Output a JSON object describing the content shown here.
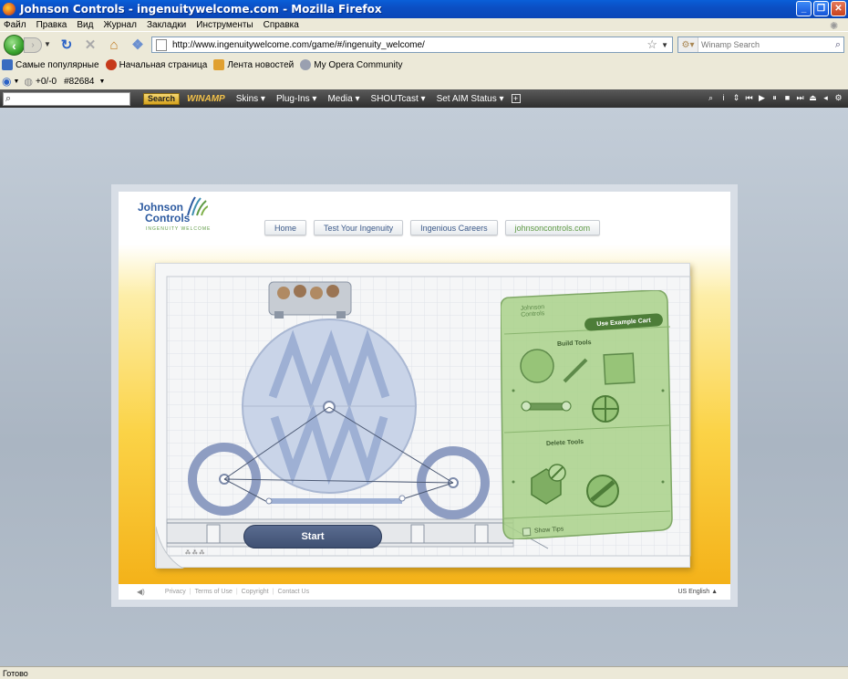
{
  "window": {
    "title": "Johnson Controls - ingenuitywelcome.com - Mozilla Firefox"
  },
  "menu": [
    "Файл",
    "Правка",
    "Вид",
    "Журнал",
    "Закладки",
    "Инструменты",
    "Справка"
  ],
  "nav": {
    "url": "http://www.ingenuitywelcome.com/game/#/ingenuity_welcome/",
    "search_placeholder": "Winamp Search"
  },
  "bookmarks": [
    {
      "label": "Самые популярные",
      "icon": "rss-icon",
      "color": "#3a6cc0"
    },
    {
      "label": "Начальная страница",
      "icon": "firefox-icon",
      "color": "#c63a1b"
    },
    {
      "label": "Лента новостей",
      "icon": "feed-icon",
      "color": "#e0a030"
    },
    {
      "label": "My Opera Community",
      "icon": "opera-icon",
      "color": "#9aa0b0"
    }
  ],
  "row3": {
    "rating": "+0/-0",
    "rank": "#82684"
  },
  "winamp": {
    "search_button": "Search",
    "logo": "WINAMP",
    "menus": [
      "Skins",
      "Plug-Ins",
      "Media",
      "SHOUTcast",
      "Set AIM Status"
    ]
  },
  "site": {
    "logo_line1": "Johnson",
    "logo_line2": "Controls",
    "logo_tagline": "INGENUITY WELCOME",
    "tabs": [
      "Home",
      "Test Your Ingenuity",
      "Ingenious Careers",
      "johnsoncontrols.com"
    ],
    "start_label": "Start",
    "panel": {
      "logo_line1": "Johnson",
      "logo_line2": "Controls",
      "example_button": "Use Example Cart",
      "build_tools": "Build Tools",
      "delete_tools": "Delete Tools",
      "show_tips": "Show Tips"
    },
    "footer_links": [
      "Privacy",
      "Terms of Use",
      "Copyright",
      "Contact Us"
    ],
    "language": "US English"
  },
  "status": "Готово",
  "colors": {
    "accent_blue": "#2c5aa0",
    "accent_green": "#5e9a44",
    "stage_yellow": "#fbd347"
  }
}
